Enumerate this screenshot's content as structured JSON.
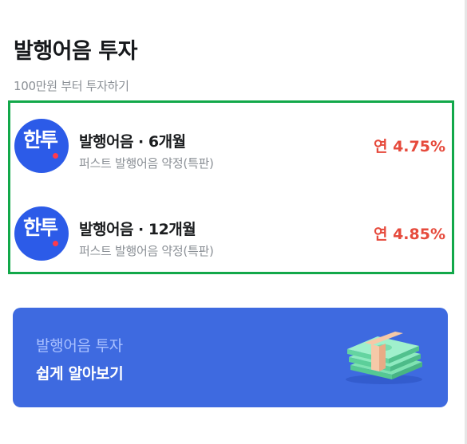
{
  "header": {
    "title": "발행어음 투자",
    "subtitle": "100만원 부터 투자하기"
  },
  "products": [
    {
      "logo_text": "한투",
      "name": "발행어음 · 6개월",
      "description": "퍼스트 발행어음 약정(특판)",
      "rate": "연 4.75%"
    },
    {
      "logo_text": "한투",
      "name": "발행어음 · 12개월",
      "description": "퍼스트 발행어음 약정(특판)",
      "rate": "연 4.85%"
    }
  ],
  "guide_banner": {
    "top_text": "발행어음 투자",
    "bottom_text": "쉽게 알아보기",
    "icon": "money-stack-icon"
  },
  "colors": {
    "brand_blue": "#2c5be8",
    "banner_blue": "#3e6ae0",
    "rate_red": "#e64a3c",
    "highlight_green": "#12a84a",
    "logo_dot_red": "#ff3a4c"
  }
}
